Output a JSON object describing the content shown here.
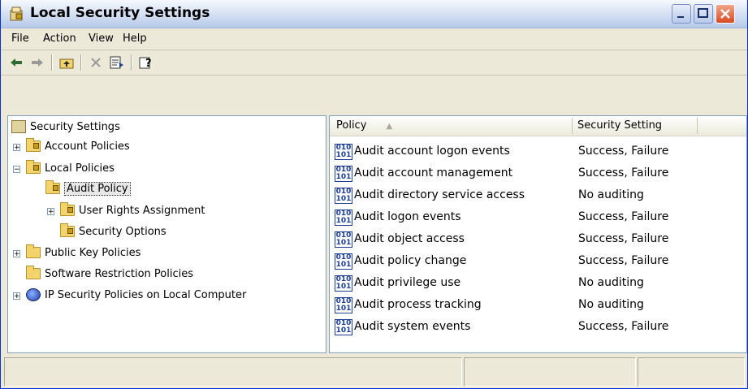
{
  "window": {
    "title": "Local Security Settings"
  },
  "menu": [
    "File",
    "Action",
    "View",
    "Help"
  ],
  "toolbar": {
    "icons": [
      "back-arrow-icon",
      "forward-arrow-icon",
      "up-folder-icon",
      "delete-icon",
      "export-list-icon",
      "help-icon"
    ]
  },
  "tree": {
    "root": "Security Settings",
    "items": [
      {
        "label": "Account Policies",
        "expander": "+"
      },
      {
        "label": "Local Policies",
        "expander": "−"
      },
      {
        "label": "Audit Policy",
        "expander": ""
      },
      {
        "label": "User Rights Assignment",
        "expander": "+"
      },
      {
        "label": "Security Options",
        "expander": ""
      },
      {
        "label": "Public Key Policies",
        "expander": "+"
      },
      {
        "label": "Software Restriction Policies",
        "expander": ""
      },
      {
        "label": "IP Security Policies on Local Computer",
        "expander": "+"
      }
    ]
  },
  "list": {
    "columns": [
      "Policy",
      "Security Setting"
    ],
    "sort_indicator": "▲",
    "rows": [
      {
        "policy": "Audit account logon events",
        "setting": "Success, Failure"
      },
      {
        "policy": "Audit account management",
        "setting": "Success, Failure"
      },
      {
        "policy": "Audit directory service access",
        "setting": "No auditing"
      },
      {
        "policy": "Audit logon events",
        "setting": "Success, Failure"
      },
      {
        "policy": "Audit object access",
        "setting": "Success, Failure"
      },
      {
        "policy": "Audit policy change",
        "setting": "Success, Failure"
      },
      {
        "policy": "Audit privilege use",
        "setting": "No auditing"
      },
      {
        "policy": "Audit process tracking",
        "setting": "No auditing"
      },
      {
        "policy": "Audit system events",
        "setting": "Success, Failure"
      }
    ]
  },
  "colors": {
    "title_gradient_top": "#f6f9fe",
    "title_gradient_bottom": "#b7c9ea",
    "chrome": "#ece9d8",
    "close_button": "#d64a22",
    "folder": "#f3d36b"
  }
}
